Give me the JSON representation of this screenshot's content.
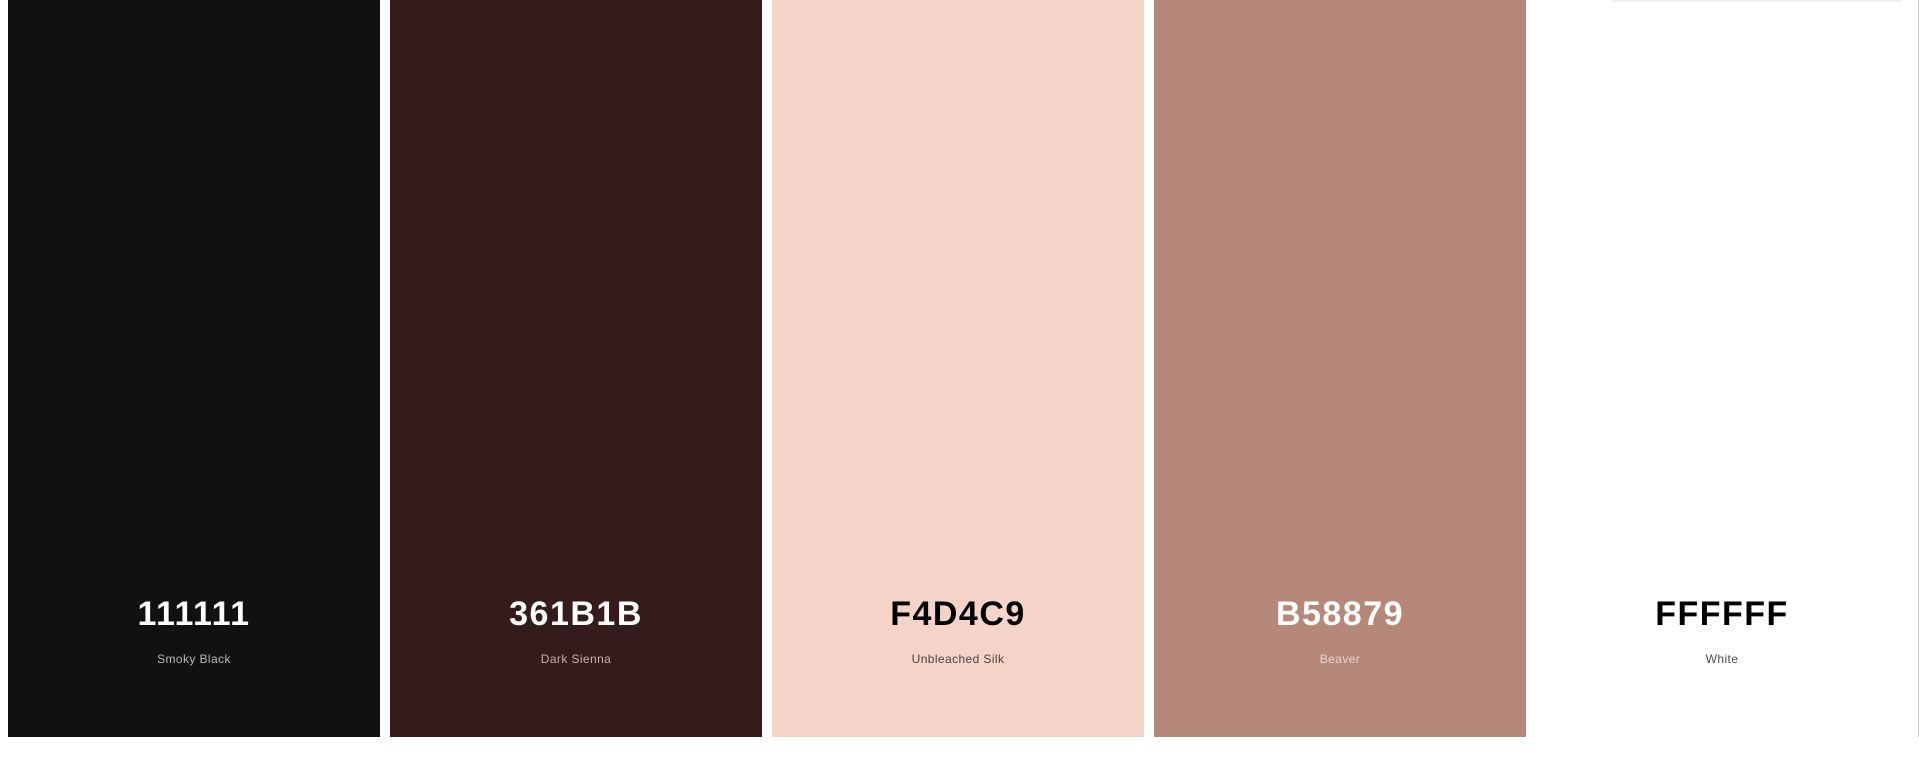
{
  "swatches": [
    {
      "hex": "111111",
      "name": "Smoky Black",
      "bg": "#111111",
      "hex_color": "#ffffff",
      "name_color": "#b9b9b9"
    },
    {
      "hex": "361B1B",
      "name": "Dark Sienna",
      "bg": "#361B1B",
      "hex_color": "#ffffff",
      "name_color": "#c4b2b2"
    },
    {
      "hex": "F4D4C9",
      "name": "Unbleached Silk",
      "bg": "#F4D4C9",
      "hex_color": "#000000",
      "name_color": "#4a3f3b"
    },
    {
      "hex": "B58879",
      "name": "Beaver",
      "bg": "#B58879",
      "hex_color": "#ffffff",
      "name_color": "#e8d6d0"
    },
    {
      "hex": "FFFFFF",
      "name": "White",
      "bg": "#FFFFFF",
      "hex_color": "#000000",
      "name_color": "#4d4d4d"
    }
  ]
}
